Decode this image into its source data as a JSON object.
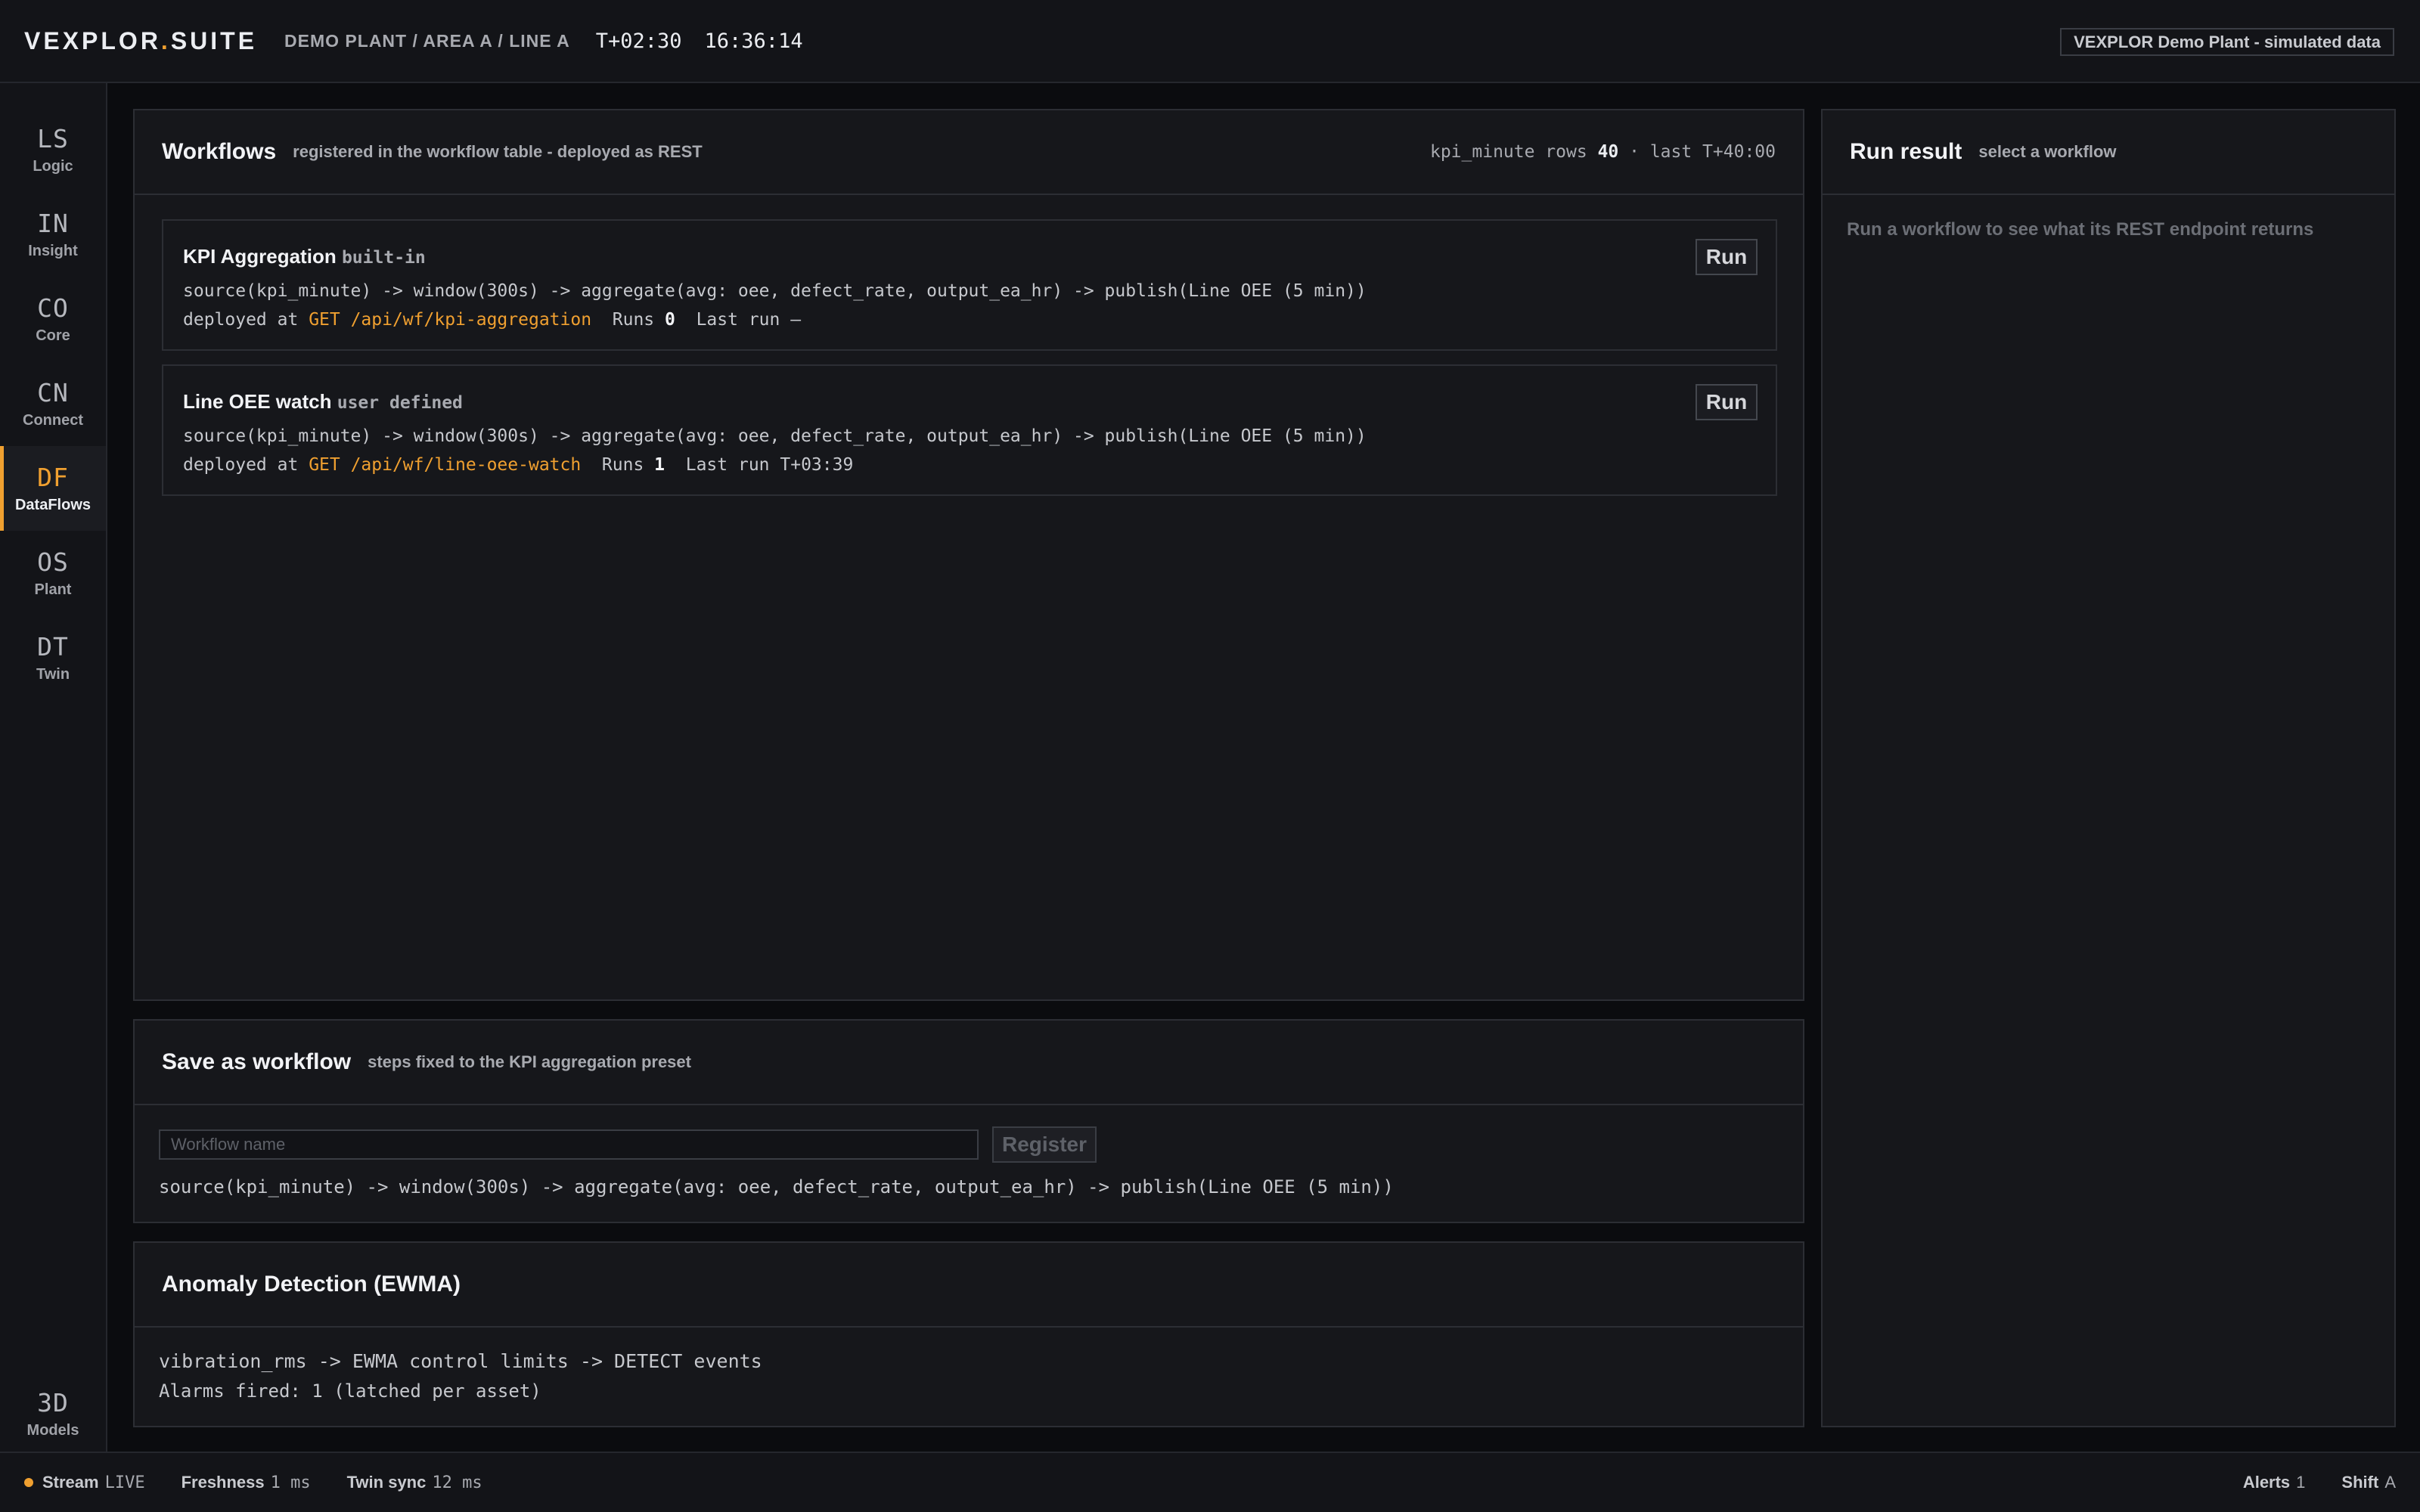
{
  "header": {
    "brand_left": "VEXPLOR",
    "brand_dot": ".",
    "brand_right": "SUITE",
    "breadcrumb": "DEMO PLANT / AREA A / LINE A",
    "time_offset": "T+02:30",
    "clock": "16:36:14",
    "environment": "VEXPLOR Demo Plant - simulated data"
  },
  "sidebar": {
    "items": [
      {
        "code": "LS",
        "label": "Logic"
      },
      {
        "code": "IN",
        "label": "Insight"
      },
      {
        "code": "CO",
        "label": "Core"
      },
      {
        "code": "CN",
        "label": "Connect"
      },
      {
        "code": "DF",
        "label": "DataFlows",
        "active": true
      },
      {
        "code": "OS",
        "label": "Plant"
      },
      {
        "code": "DT",
        "label": "Twin"
      }
    ],
    "bottom_item": {
      "code": "3D",
      "label": "Models"
    }
  },
  "workflows": {
    "title": "Workflows",
    "subtitle": "registered in the workflow table - deployed as REST",
    "meta_prefix": "kpi_minute rows",
    "meta_rows": "40",
    "meta_suffix": "· last T+40:00",
    "items": [
      {
        "name": "KPI Aggregation",
        "tag": "built-in",
        "steps": "source(kpi_minute) -> window(300s) -> aggregate(avg: oee, defect_rate, output_ea_hr) -> publish(Line OEE (5 min))",
        "deployed_label": "deployed at",
        "endpoint": "GET /api/wf/kpi-aggregation",
        "runs_label": "Runs",
        "runs": "0",
        "last_run_label": "Last run",
        "last_run": "–",
        "run_label": "Run"
      },
      {
        "name": "Line OEE watch",
        "tag": "user defined",
        "steps": "source(kpi_minute) -> window(300s) -> aggregate(avg: oee, defect_rate, output_ea_hr) -> publish(Line OEE (5 min))",
        "deployed_label": "deployed at",
        "endpoint": "GET /api/wf/line-oee-watch",
        "runs_label": "Runs",
        "runs": "1",
        "last_run_label": "Last run",
        "last_run": "T+03:39",
        "run_label": "Run"
      }
    ]
  },
  "save_workflow": {
    "title": "Save as workflow",
    "subtitle": "steps fixed to the KPI aggregation preset",
    "name_placeholder": "Workflow name",
    "name_value": "",
    "register_label": "Register",
    "steps": "source(kpi_minute) -> window(300s) -> aggregate(avg: oee, defect_rate, output_ea_hr) -> publish(Line OEE (5 min))"
  },
  "anomaly": {
    "title": "Anomaly Detection (EWMA)",
    "pipeline": "vibration_rms -> EWMA control limits -> DETECT events",
    "alarms": "Alarms fired: 1 (latched per asset)"
  },
  "run_result": {
    "title": "Run result",
    "subtitle": "select a workflow",
    "empty_message": "Run a workflow to see what its REST endpoint returns"
  },
  "statusbar": {
    "stream_label": "Stream",
    "stream_value": "LIVE",
    "freshness_label": "Freshness",
    "freshness_value": "1 ms",
    "twin_label": "Twin sync",
    "twin_value": "12 ms",
    "alerts_label": "Alerts",
    "alerts_value": "1",
    "shift_label": "Shift",
    "shift_value": "A"
  },
  "colors": {
    "accent": "#f0a030",
    "background": "#0b0c0f",
    "panel": "#16171b",
    "border": "#2c2e34"
  },
  "icons": {
    "stream_status": "live-dot-icon"
  }
}
